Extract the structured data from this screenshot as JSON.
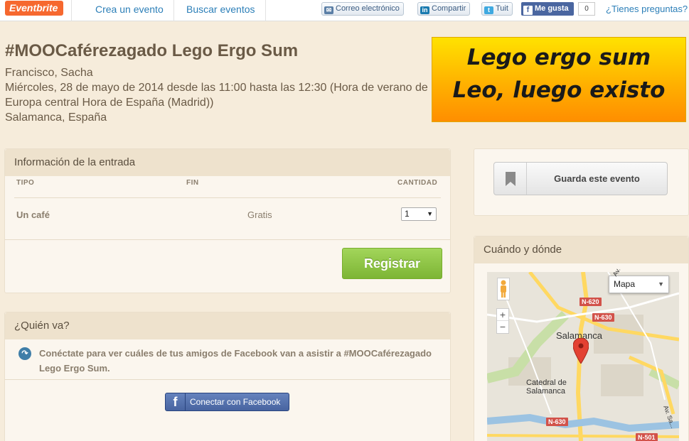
{
  "topbar": {
    "logo": "Eventbrite",
    "nav": [
      "Crea un evento",
      "Buscar eventos"
    ],
    "share": {
      "email": "Correo electrónico",
      "linkedin": "Compartir",
      "twitter": "Tuit"
    },
    "facebook_like": "Me gusta",
    "like_count": "0",
    "help": "¿Tienes preguntas?"
  },
  "event": {
    "title": "#MOOCaférezagado Lego Ergo Sum",
    "organizer": "Francisco, Sacha",
    "datetime": "Miércoles, 28 de mayo de 2014 desde las 11:00 hasta las 12:30 (Hora de verano de Europa central Hora de España (Madrid))",
    "location": "Salamanca, España",
    "banner_line1": "Lego ergo sum",
    "banner_line2": "Leo, luego existo"
  },
  "tickets": {
    "heading": "Información de la entrada",
    "columns": [
      "TIPO",
      "FIN",
      "CANTIDAD"
    ],
    "rows": [
      {
        "type": "Un café",
        "price": "Gratis",
        "quantity": "1"
      }
    ],
    "register": "Registrar"
  },
  "who": {
    "heading": "¿Quién va?",
    "text": "Conéctate para ver cuáles de tus amigos de Facebook van a asistir a #MOOCaférezagado Lego Ergo Sum.",
    "connect": "Conectar con Facebook"
  },
  "sidebar": {
    "save": "Guarda este evento",
    "where_heading": "Cuándo y dónde",
    "map_type": "Mapa",
    "map_labels": {
      "city": "Salamanca",
      "cathedral_1": "Catedral de",
      "cathedral_2": "Salamanca",
      "avenue_1": "Av.",
      "avenue_2": "Av. Sa...",
      "roads": [
        "N-620",
        "N-630",
        "N-630",
        "N-501"
      ]
    }
  },
  "colors": {
    "accent": "#f6682f",
    "link": "#2c7fb8",
    "register": "#8ec346",
    "facebook": "#4a66a0"
  }
}
